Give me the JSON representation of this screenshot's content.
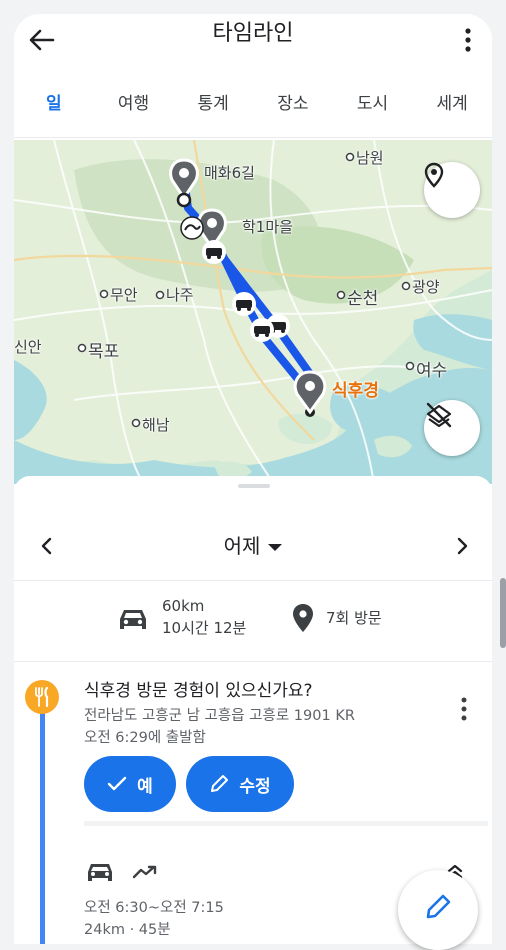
{
  "app": {
    "title": "타임라인"
  },
  "tabs": [
    {
      "label": "일",
      "active": true
    },
    {
      "label": "여행",
      "active": false
    },
    {
      "label": "통계",
      "active": false
    },
    {
      "label": "장소",
      "active": false
    },
    {
      "label": "도시",
      "active": false
    },
    {
      "label": "세계",
      "active": false
    }
  ],
  "map": {
    "labels": {
      "maehwa": "매화6길",
      "hak1": "학1마을",
      "namwon": "남원",
      "muan": "무안",
      "naju": "나주",
      "suncheon": "순천",
      "gwangyang": "광양",
      "sinan": "신안",
      "mokpo": "목포",
      "yeosu": "여수",
      "sikhugyeong": "식후경",
      "haenam": "해남"
    },
    "route_color": "#1a56e8"
  },
  "day_nav": {
    "label": "어제"
  },
  "summary": {
    "distance": "60km",
    "duration": "10시간 12분",
    "visits": "7회 방문"
  },
  "place": {
    "title": "식후경 방문 경험이 있으신가요?",
    "address": "전라남도 고흥군 남 고흥읍 고흥로 1901 KR",
    "departed": "오전 6:29에 출발함",
    "icon": "restaurant-icon",
    "icon_color": "#f9a825"
  },
  "actions": {
    "yes": "예",
    "edit": "수정"
  },
  "movement": {
    "time": "오전 6:30~오전 7:15",
    "distance": "24km · 45분"
  },
  "colors": {
    "accent": "#1a73e8",
    "timeline": "#4285f4"
  }
}
